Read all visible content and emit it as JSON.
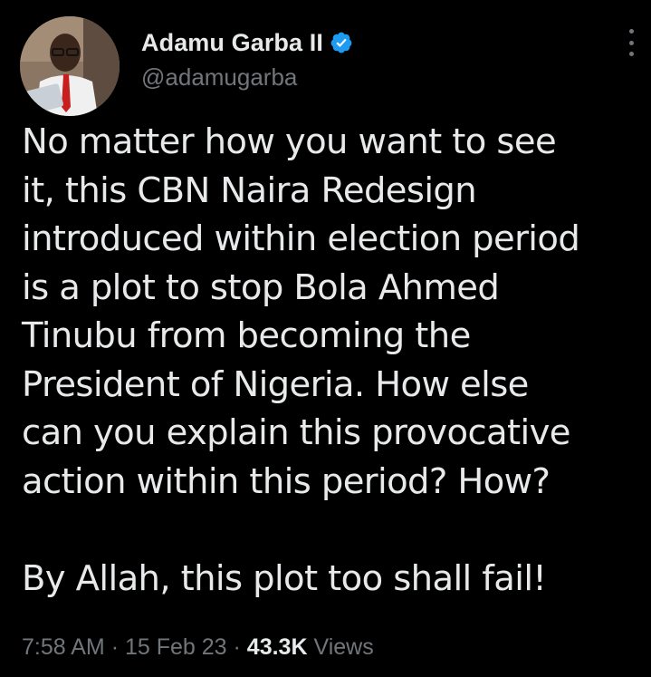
{
  "author": {
    "display_name": "Adamu Garba II",
    "handle": "@adamugarba",
    "verified_icon": "verified-badge-icon",
    "avatar_icon": "avatar"
  },
  "menu": {
    "icon": "more-options-icon"
  },
  "tweet": {
    "paragraph1": "No matter how you want to see\nit, this CBN Naira Redesign\nintroduced within election period\nis a plot to stop Bola Ahmed\nTinubu from becoming the\nPresident of Nigeria. How else\ncan you explain this provocative\naction within this period? How?",
    "paragraph2": "By Allah, this plot too shall fail!"
  },
  "meta": {
    "time": "7:58 AM",
    "separator": "·",
    "date": "15 Feb 23",
    "views_count": "43.3K",
    "views_label": "Views"
  },
  "colors": {
    "background": "#000000",
    "text": "#e7e9ea",
    "secondary": "#71767b",
    "verified": "#1d9bf0"
  }
}
